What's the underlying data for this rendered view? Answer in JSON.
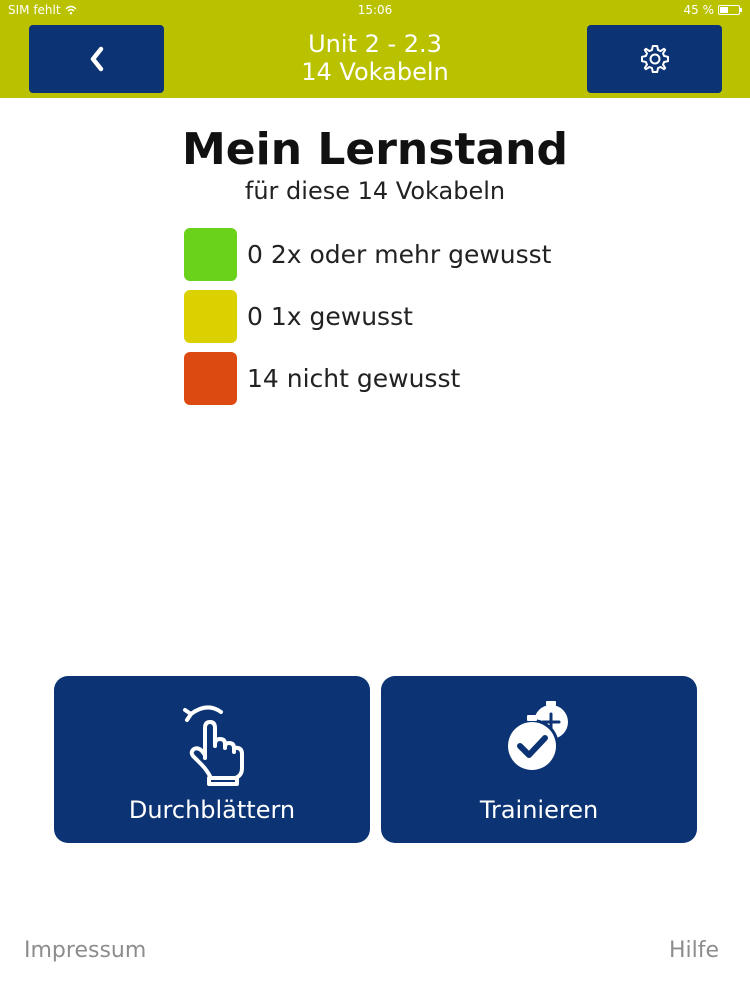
{
  "status_bar": {
    "carrier": "SIM fehlt",
    "time": "15:06",
    "battery": "45 %"
  },
  "header": {
    "title": "Unit 2 - 2.3",
    "subtitle": "14 Vokabeln",
    "back_icon": "chevron-left-icon",
    "settings_icon": "gear-icon"
  },
  "main": {
    "title": "Mein Lernstand",
    "subtitle": "für diese 14 Vokabeln",
    "legend": [
      {
        "count": "0",
        "label": "2x oder mehr gewusst",
        "text": "0 2x oder mehr gewusst",
        "color": "#6bd21c"
      },
      {
        "count": "0",
        "label": "1x gewusst",
        "text": "0 1x gewusst",
        "color": "#dcd100"
      },
      {
        "count": "14",
        "label": "nicht gewusst",
        "text": "14 nicht gewusst",
        "color": "#dd4a11"
      }
    ]
  },
  "actions": {
    "browse_label": "Durchblättern",
    "browse_icon": "swipe-hand-icon",
    "train_label": "Trainieren",
    "train_icon": "stopwatch-check-icon"
  },
  "footer": {
    "impressum": "Impressum",
    "help": "Hilfe"
  },
  "colors": {
    "header_bg": "#bac200",
    "button_bg": "#0c3373",
    "footer_text": "#8d8d8d"
  }
}
